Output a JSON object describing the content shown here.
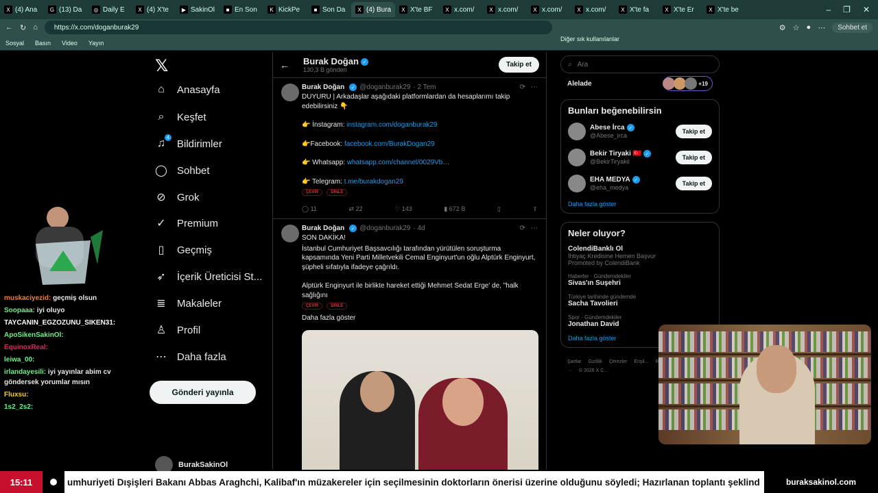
{
  "browser": {
    "tabs": [
      {
        "label": "(4) Ana",
        "fav": "X",
        "active": false
      },
      {
        "label": "(13) Da",
        "fav": "G",
        "active": false
      },
      {
        "label": "Daily E",
        "fav": "◎",
        "active": false
      },
      {
        "label": "(4) X'te",
        "fav": "X",
        "active": false
      },
      {
        "label": "SakinOl",
        "fav": "▶",
        "active": false
      },
      {
        "label": "En Son",
        "fav": "■",
        "active": false
      },
      {
        "label": "KickPe",
        "fav": "K",
        "active": false
      },
      {
        "label": "Son Da",
        "fav": "■",
        "active": false
      },
      {
        "label": "(4) Bura",
        "fav": "X",
        "active": true
      },
      {
        "label": "X'te BF",
        "fav": "X",
        "active": false
      },
      {
        "label": "x.com/",
        "fav": "X",
        "active": false
      },
      {
        "label": "x.com/",
        "fav": "X",
        "active": false
      },
      {
        "label": "x.com/",
        "fav": "X",
        "active": false
      },
      {
        "label": "x.com/",
        "fav": "X",
        "active": false
      },
      {
        "label": "X'te fa",
        "fav": "X",
        "active": false
      },
      {
        "label": "X'te Er",
        "fav": "X",
        "active": false
      },
      {
        "label": "X'te be",
        "fav": "X",
        "active": false
      }
    ],
    "url": "https://x.com/doganburak29",
    "chat_button": "Sohbet et",
    "bookmarks": [
      "Sosyal",
      "Basın",
      "Video",
      "Yayın"
    ],
    "other_bookmarks": "Diğer sık kullanılanlar"
  },
  "nav": {
    "items": [
      {
        "label": "Anasayfa",
        "icon": "⌂"
      },
      {
        "label": "Keşfet",
        "icon": "⌕"
      },
      {
        "label": "Bildirimler",
        "icon": "♫"
      },
      {
        "label": "Sohbet",
        "icon": "◯"
      },
      {
        "label": "Grok",
        "icon": "⊘"
      },
      {
        "label": "Premium",
        "icon": "✓"
      },
      {
        "label": "Geçmiş",
        "icon": "▯"
      },
      {
        "label": "İçerik Üreticisi St...",
        "icon": "➶"
      },
      {
        "label": "Makaleler",
        "icon": "≣"
      },
      {
        "label": "Profil",
        "icon": "♙"
      },
      {
        "label": "Daha fazla",
        "icon": "⋯"
      }
    ],
    "notif_badge": "4",
    "post_button": "Gönderi yayınla",
    "account_name": "BurakSakinOl"
  },
  "chat": [
    {
      "user": "muskaciyezid:",
      "msg": "geçmiş olsun",
      "color": "#ff7a1a"
    },
    {
      "user": "Soopaaa:",
      "msg": "iyi oluyo",
      "color": "#6cf08a"
    },
    {
      "user": "TAYCANIN_EGZOZUNU_SIKEN31:",
      "msg": "",
      "color": "#ffffff"
    },
    {
      "user": "ApoSikenSakinOl:",
      "msg": "",
      "color": "#6cf08a"
    },
    {
      "user": "EquinoxReal:",
      "msg": "",
      "color": "#e0245e"
    },
    {
      "user": "leiwa_00:",
      "msg": "",
      "color": "#6cf08a"
    },
    {
      "user": "irlandayesili:",
      "msg": "iyi yayınlar abim cv göndersek yorumlar mısın",
      "color": "#6cf08a"
    },
    {
      "user": "Fluxsu:",
      "msg": "",
      "color": "#f5d020"
    },
    {
      "user": "1s2_2s2:",
      "msg": "",
      "color": "#6cf08a"
    }
  ],
  "profile": {
    "name": "Burak Doğan",
    "posts_count": "130,3 B gönderi",
    "follow": "Takip et"
  },
  "tweets": [
    {
      "name": "Burak Doğan",
      "handle": "@doganburak29",
      "time": "· 2 Tem",
      "lines": [
        "DUYURU | Arkadaşlar aşağıdaki platformlardan da hesaplarımı takip edebilirsiniz 👇"
      ],
      "links": [
        {
          "label": "👉 İnstagram:",
          "url": "instagram.com/doganburak29"
        },
        {
          "label": "👉Facebook:",
          "url": "facebook.com/BurakDogan29"
        },
        {
          "label": "👉 Whatsapp:",
          "url": "whatsapp.com/channel/0029Vb…"
        },
        {
          "label": "👉 Telegram:",
          "url": "t.me/burakdogan29"
        }
      ],
      "pills": [
        "ÇEVİR",
        "DİNLE"
      ],
      "replies": "11",
      "reposts": "22",
      "likes": "143",
      "views": "672 B"
    },
    {
      "name": "Burak Doğan",
      "handle": "@doganburak29",
      "time": "· 4d",
      "lines": [
        "SON DAKİKA!",
        "İstanbul Cumhuriyet Başsavcılığı tarafından yürütülen soruşturma kapsamında Yeni Parti Milletvekili Cemal Enginyurt'un oğlu Alptürk Enginyurt, şüpheli sıfatıyla ifadeye çağrıldı.",
        "Alptürk Enginyurt ile birlikte  hareket ettiği Mehmet Sedat Erge' de, \"halk sağlığını"
      ],
      "pills": [
        "ÇEVİR",
        "DİNLE"
      ],
      "show_more": "Daha fazla göster"
    }
  ],
  "right": {
    "search_placeholder": "Ara",
    "alelade": "Alelade",
    "alelade_count": "+19",
    "suggest_title": "Bunları beğenebilirsin",
    "suggestions": [
      {
        "name": "Abese İrca",
        "handle": "@Abese_irca",
        "btn": "Takip et"
      },
      {
        "name": "Bekir Tiryaki 🇹🇷",
        "handle": "@BekirTiryakil",
        "btn": "Takip et"
      },
      {
        "name": "EHA MEDYA",
        "handle": "@eha_medya",
        "btn": "Takip et"
      }
    ],
    "show_more": "Daha fazla göster",
    "trends_title": "Neler oluyor?",
    "trends": [
      {
        "cat": "",
        "title": "ColendiBanklı Ol",
        "sub": "İhtiyaç Kredisine Hemen Başvur",
        "promo": "Promoted by ColendiBank"
      },
      {
        "cat": "Haberler · Gündemdekiler",
        "title": "Sivas'ın Suşehri",
        "sub": "",
        "promo": ""
      },
      {
        "cat": "Türkiye tarihinde gündemde",
        "title": "Sacha Tavolieri",
        "sub": "",
        "promo": ""
      },
      {
        "cat": "Spor · Gündemdekiler",
        "title": "Jonathan David",
        "sub": "",
        "promo": ""
      }
    ],
    "trends_more": "Daha fazla göster",
    "footer": [
      "Şartlar",
      "Gizlilik",
      "Çerezler",
      "Erişil...",
      "Reklam Bilgileri",
      "Daha fazla ···",
      "© 2026 X C..."
    ]
  },
  "ticker": {
    "time": "15:11",
    "text": "umhuriyeti Dışişleri Bakanı Abbas Araghchi, Kalibaf'ın müzakereler için seçilmesinin doktorların önerisi üzerine olduğunu söyledi; Hazırlanan toplantı şeklind",
    "site": "buraksakinol.com"
  }
}
